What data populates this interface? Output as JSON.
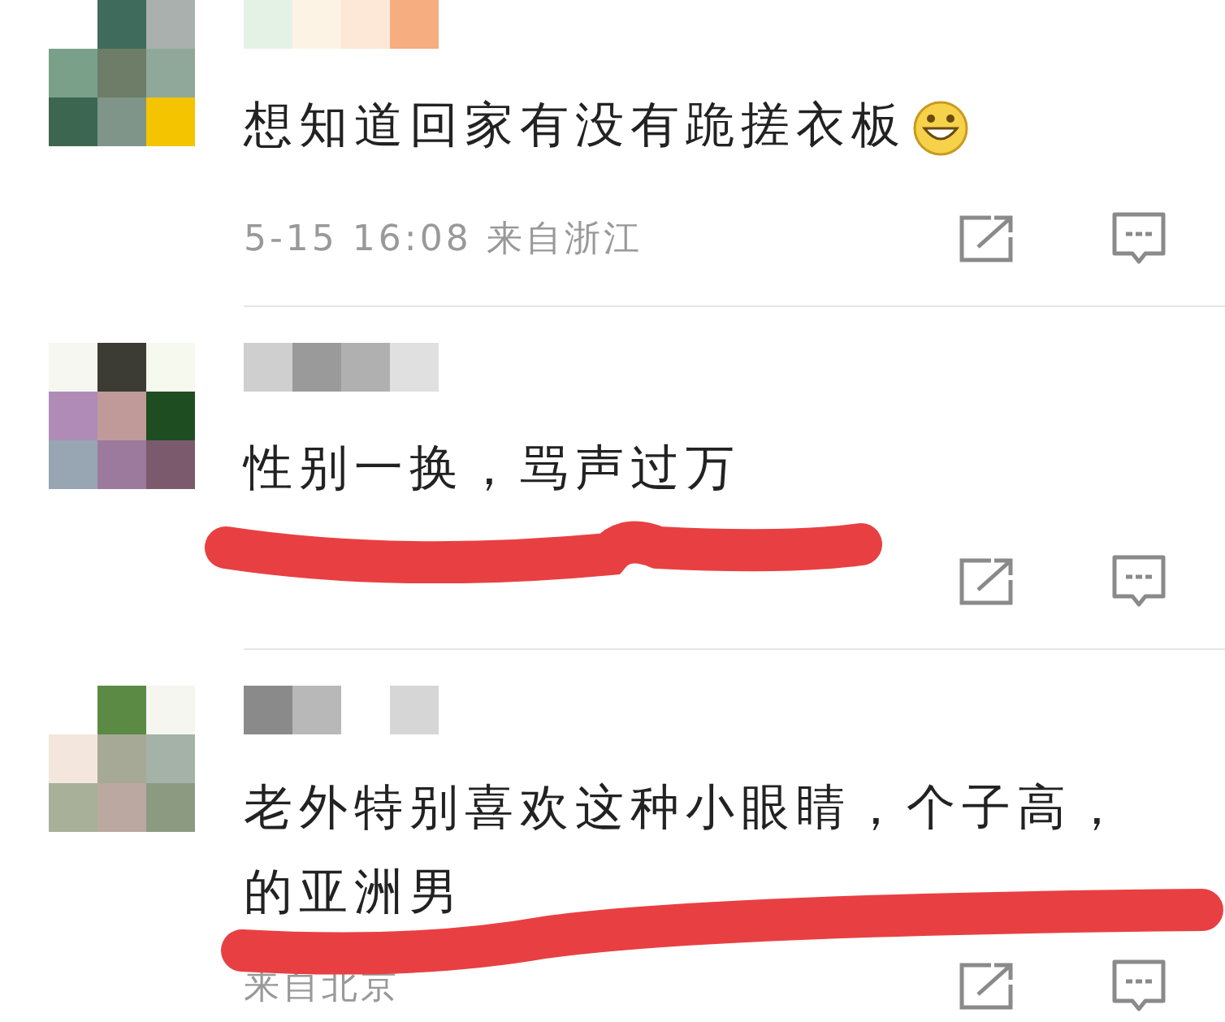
{
  "comments": [
    {
      "lines": [
        "想知道回家有没有跪搓衣板"
      ],
      "emoji": true,
      "meta": "5-15 16:08 来自浙江",
      "redacted": false
    },
    {
      "lines": [
        "性别一换，骂声过万"
      ],
      "emoji": false,
      "redacted": true
    },
    {
      "lines": [
        "老外特别喜欢这种小眼睛，个子高，",
        "的亚洲男"
      ],
      "emoji": false,
      "meta": "来自北京",
      "redacted": true
    }
  ]
}
